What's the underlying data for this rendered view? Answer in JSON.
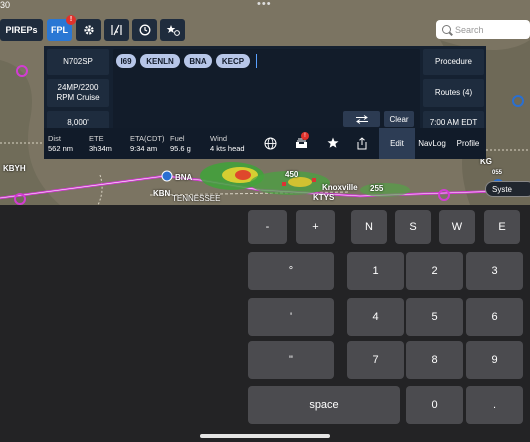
{
  "status": {
    "time": "30",
    "dots": "•••"
  },
  "toolbar": {
    "pireps_label": "PIREPs",
    "fpl_label": "FPL",
    "fpl_badge": "!",
    "drawer_badge": "!"
  },
  "search": {
    "placeholder": "Search"
  },
  "fpl": {
    "aircraft": "N702SP",
    "power": "24MP/2200\nRPM Cruise",
    "altitude": "8,000'",
    "waypoints": [
      "I69",
      "KENLN",
      "BNA",
      "KECP"
    ],
    "procedure": "Procedure",
    "routes": "Routes (4)",
    "time": "7:00 AM EDT",
    "clear": "Clear"
  },
  "stats": {
    "dist_label": "Dist",
    "dist_value": "562 nm",
    "ete_label": "ETE",
    "ete_value": "3h34m",
    "eta_label": "ETA(CDT)",
    "eta_value": "9:34 am",
    "fuel_label": "Fuel",
    "fuel_value": "95.6 g",
    "wind_label": "Wind",
    "wind_value": "4 kts head"
  },
  "tabs": {
    "edit": "Edit",
    "navlog": "NavLog",
    "profile": "Profile"
  },
  "map": {
    "labels": [
      "KBYH",
      "KBN",
      "BNA",
      "TENNESSEE",
      "Knoxville",
      "KTYS",
      "450",
      "255",
      "055",
      "KG"
    ],
    "system_button": "Syste"
  },
  "keypad": {
    "minus": "-",
    "plus": "+",
    "n": "N",
    "s": "S",
    "w": "W",
    "e": "E",
    "degree": "°",
    "minute": "'",
    "second": "\"",
    "one": "1",
    "two": "2",
    "three": "3",
    "four": "4",
    "five": "5",
    "six": "6",
    "seven": "7",
    "eight": "8",
    "nine": "9",
    "space": "space",
    "zero": "0",
    "dot": "."
  }
}
